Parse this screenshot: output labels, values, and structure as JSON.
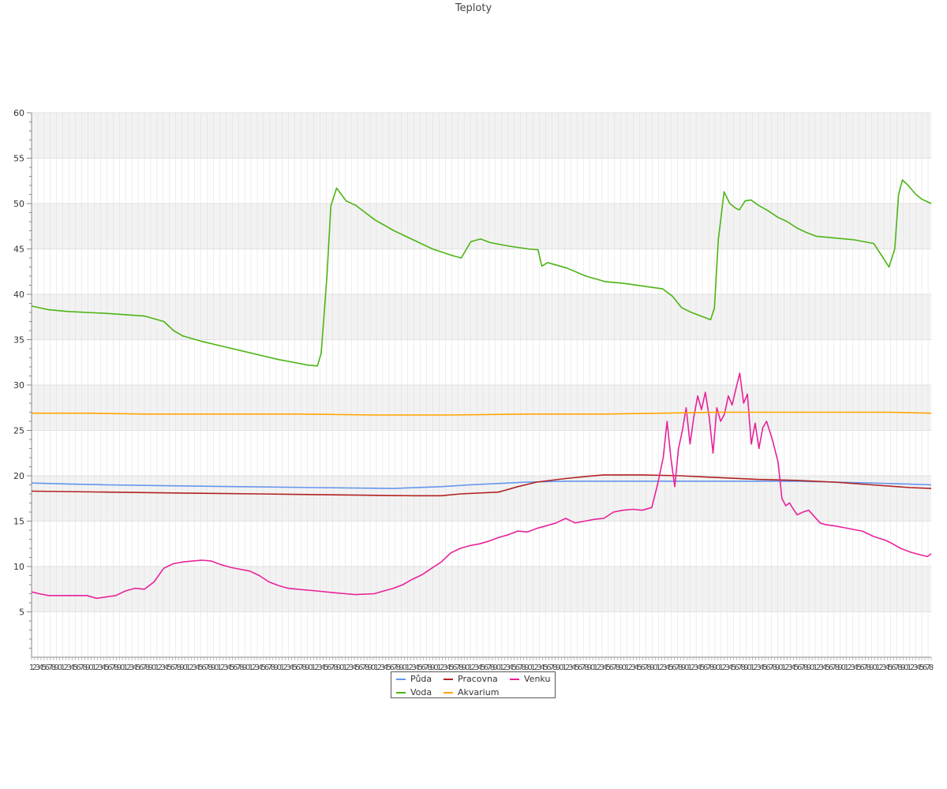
{
  "chart_data": {
    "type": "line",
    "title": "Teploty",
    "xlabel": "",
    "ylabel": "",
    "ylim": [
      0,
      60
    ],
    "yticks": [
      5,
      10,
      15,
      20,
      25,
      30,
      35,
      40,
      45,
      50,
      55,
      60
    ],
    "x_range": [
      1,
      288
    ],
    "x_tick_labels": "1 3 5 6 7 8 ... 288 (one dense label per sample, overlapping)",
    "grid": "alternating horizontal bands and vertical lines per sample",
    "legend_position": "bottom-center",
    "series": [
      {
        "name": "Půda",
        "color": "#6495ed",
        "points": [
          [
            1,
            19.2
          ],
          [
            20,
            19.1
          ],
          [
            40,
            19.0
          ],
          [
            70,
            18.9
          ],
          [
            110,
            18.8
          ],
          [
            150,
            18.7
          ],
          [
            190,
            18.6
          ],
          [
            215,
            18.8
          ],
          [
            230,
            19.0
          ],
          [
            250,
            19.2
          ],
          [
            260,
            19.3
          ],
          [
            280,
            19.4
          ],
          [
            300,
            19.4
          ],
          [
            330,
            19.4
          ],
          [
            360,
            19.4
          ],
          [
            400,
            19.4
          ],
          [
            420,
            19.3
          ],
          [
            440,
            19.2
          ],
          [
            458,
            19.1
          ],
          [
            471,
            19.0
          ]
        ]
      },
      {
        "name": "Pracovna",
        "color": "#b22222",
        "points": [
          [
            1,
            18.3
          ],
          [
            40,
            18.2
          ],
          [
            80,
            18.1
          ],
          [
            120,
            18.0
          ],
          [
            160,
            17.9
          ],
          [
            200,
            17.8
          ],
          [
            215,
            17.8
          ],
          [
            225,
            18.0
          ],
          [
            245,
            18.2
          ],
          [
            255,
            18.8
          ],
          [
            265,
            19.3
          ],
          [
            280,
            19.7
          ],
          [
            290,
            19.9
          ],
          [
            300,
            20.1
          ],
          [
            320,
            20.1
          ],
          [
            340,
            20.0
          ],
          [
            360,
            19.8
          ],
          [
            380,
            19.6
          ],
          [
            400,
            19.5
          ],
          [
            420,
            19.3
          ],
          [
            440,
            19.0
          ],
          [
            460,
            18.7
          ],
          [
            471,
            18.6
          ]
        ]
      },
      {
        "name": "Venku",
        "color": "#e8229a",
        "points": [
          [
            1,
            7.2
          ],
          [
            5,
            7.0
          ],
          [
            10,
            6.8
          ],
          [
            20,
            6.8
          ],
          [
            30,
            6.8
          ],
          [
            35,
            6.5
          ],
          [
            45,
            6.8
          ],
          [
            50,
            7.3
          ],
          [
            55,
            7.6
          ],
          [
            60,
            7.5
          ],
          [
            65,
            8.3
          ],
          [
            70,
            9.8
          ],
          [
            75,
            10.3
          ],
          [
            80,
            10.5
          ],
          [
            85,
            10.6
          ],
          [
            90,
            10.7
          ],
          [
            95,
            10.6
          ],
          [
            100,
            10.2
          ],
          [
            105,
            9.9
          ],
          [
            110,
            9.7
          ],
          [
            115,
            9.5
          ],
          [
            120,
            9.0
          ],
          [
            125,
            8.3
          ],
          [
            130,
            7.9
          ],
          [
            135,
            7.6
          ],
          [
            140,
            7.5
          ],
          [
            150,
            7.3
          ],
          [
            160,
            7.1
          ],
          [
            165,
            7.0
          ],
          [
            170,
            6.9
          ],
          [
            180,
            7.0
          ],
          [
            185,
            7.3
          ],
          [
            190,
            7.6
          ],
          [
            195,
            8.0
          ],
          [
            200,
            8.6
          ],
          [
            205,
            9.1
          ],
          [
            210,
            9.8
          ],
          [
            215,
            10.5
          ],
          [
            220,
            11.5
          ],
          [
            225,
            12.0
          ],
          [
            230,
            12.3
          ],
          [
            235,
            12.5
          ],
          [
            240,
            12.8
          ],
          [
            245,
            13.2
          ],
          [
            250,
            13.5
          ],
          [
            255,
            13.9
          ],
          [
            260,
            13.8
          ],
          [
            265,
            14.2
          ],
          [
            270,
            14.5
          ],
          [
            275,
            14.8
          ],
          [
            280,
            15.3
          ],
          [
            285,
            14.8
          ],
          [
            290,
            15.0
          ],
          [
            295,
            15.2
          ],
          [
            300,
            15.3
          ],
          [
            305,
            16.0
          ],
          [
            310,
            16.2
          ],
          [
            315,
            16.3
          ],
          [
            320,
            16.2
          ],
          [
            325,
            16.5
          ],
          [
            328,
            19.0
          ],
          [
            331,
            22.0
          ],
          [
            333,
            26.0
          ],
          [
            335,
            22.0
          ],
          [
            337,
            18.8
          ],
          [
            339,
            23.0
          ],
          [
            341,
            25.0
          ],
          [
            343,
            27.5
          ],
          [
            345,
            23.5
          ],
          [
            347,
            26.5
          ],
          [
            349,
            28.8
          ],
          [
            351,
            27.3
          ],
          [
            353,
            29.2
          ],
          [
            355,
            26.5
          ],
          [
            357,
            22.5
          ],
          [
            359,
            27.5
          ],
          [
            361,
            26.0
          ],
          [
            363,
            26.8
          ],
          [
            365,
            28.8
          ],
          [
            367,
            27.8
          ],
          [
            369,
            29.6
          ],
          [
            371,
            31.3
          ],
          [
            373,
            28.0
          ],
          [
            375,
            29.0
          ],
          [
            377,
            23.5
          ],
          [
            379,
            25.8
          ],
          [
            381,
            23.0
          ],
          [
            383,
            25.3
          ],
          [
            385,
            26.0
          ],
          [
            388,
            24.0
          ],
          [
            391,
            21.5
          ],
          [
            393,
            17.5
          ],
          [
            395,
            16.7
          ],
          [
            397,
            17.0
          ],
          [
            399,
            16.3
          ],
          [
            401,
            15.7
          ],
          [
            404,
            16.0
          ],
          [
            407,
            16.2
          ],
          [
            410,
            15.5
          ],
          [
            413,
            14.8
          ],
          [
            416,
            14.6
          ],
          [
            420,
            14.5
          ],
          [
            425,
            14.3
          ],
          [
            430,
            14.1
          ],
          [
            435,
            13.9
          ],
          [
            438,
            13.6
          ],
          [
            441,
            13.3
          ],
          [
            444,
            13.1
          ],
          [
            447,
            12.9
          ],
          [
            450,
            12.6
          ],
          [
            455,
            12.0
          ],
          [
            460,
            11.6
          ],
          [
            465,
            11.3
          ],
          [
            469,
            11.1
          ],
          [
            471,
            11.4
          ]
        ]
      },
      {
        "name": "Voda",
        "color": "#4cb414",
        "points": [
          [
            1,
            38.7
          ],
          [
            10,
            38.3
          ],
          [
            20,
            38.1
          ],
          [
            40,
            37.9
          ],
          [
            60,
            37.6
          ],
          [
            70,
            37.0
          ],
          [
            75,
            36.0
          ],
          [
            80,
            35.4
          ],
          [
            90,
            34.8
          ],
          [
            100,
            34.3
          ],
          [
            110,
            33.8
          ],
          [
            120,
            33.3
          ],
          [
            130,
            32.8
          ],
          [
            140,
            32.4
          ],
          [
            145,
            32.2
          ],
          [
            150,
            32.1
          ],
          [
            152,
            33.5
          ],
          [
            155,
            42.0
          ],
          [
            157,
            49.7
          ],
          [
            160,
            51.7
          ],
          [
            165,
            50.3
          ],
          [
            170,
            49.8
          ],
          [
            175,
            49.0
          ],
          [
            180,
            48.2
          ],
          [
            190,
            47.0
          ],
          [
            200,
            46.0
          ],
          [
            210,
            45.0
          ],
          [
            220,
            44.3
          ],
          [
            225,
            44.0
          ],
          [
            230,
            45.8
          ],
          [
            235,
            46.1
          ],
          [
            240,
            45.7
          ],
          [
            250,
            45.3
          ],
          [
            260,
            45.0
          ],
          [
            265,
            44.9
          ],
          [
            267,
            43.1
          ],
          [
            270,
            43.5
          ],
          [
            280,
            42.9
          ],
          [
            290,
            42.0
          ],
          [
            300,
            41.4
          ],
          [
            310,
            41.2
          ],
          [
            320,
            40.9
          ],
          [
            330,
            40.6
          ],
          [
            335,
            39.8
          ],
          [
            340,
            38.5
          ],
          [
            345,
            38.0
          ],
          [
            350,
            37.6
          ],
          [
            355,
            37.2
          ],
          [
            357,
            38.5
          ],
          [
            359,
            46.0
          ],
          [
            362,
            51.3
          ],
          [
            365,
            50.0
          ],
          [
            368,
            49.5
          ],
          [
            370,
            49.3
          ],
          [
            373,
            50.3
          ],
          [
            376,
            50.4
          ],
          [
            380,
            49.8
          ],
          [
            385,
            49.2
          ],
          [
            390,
            48.5
          ],
          [
            395,
            48.0
          ],
          [
            400,
            47.3
          ],
          [
            405,
            46.8
          ],
          [
            410,
            46.4
          ],
          [
            420,
            46.2
          ],
          [
            430,
            46.0
          ],
          [
            440,
            45.6
          ],
          [
            445,
            44.0
          ],
          [
            448,
            43.0
          ],
          [
            451,
            45.0
          ],
          [
            453,
            51.0
          ],
          [
            455,
            52.6
          ],
          [
            458,
            52.0
          ],
          [
            462,
            51.0
          ],
          [
            465,
            50.5
          ],
          [
            470,
            50.0
          ]
        ]
      },
      {
        "name": "Akvarium",
        "color": "#ffa500",
        "points": [
          [
            1,
            26.9
          ],
          [
            30,
            26.9
          ],
          [
            60,
            26.8
          ],
          [
            100,
            26.8
          ],
          [
            140,
            26.8
          ],
          [
            180,
            26.7
          ],
          [
            220,
            26.7
          ],
          [
            260,
            26.8
          ],
          [
            300,
            26.8
          ],
          [
            330,
            26.9
          ],
          [
            360,
            27.0
          ],
          [
            390,
            27.0
          ],
          [
            420,
            27.0
          ],
          [
            450,
            27.0
          ],
          [
            471,
            26.9
          ]
        ]
      }
    ]
  },
  "legend": {
    "items": [
      {
        "label": "Půda",
        "color": "#6495ed"
      },
      {
        "label": "Pracovna",
        "color": "#b22222"
      },
      {
        "label": "Venku",
        "color": "#e8229a"
      },
      {
        "label": "Voda",
        "color": "#4cb414"
      },
      {
        "label": "Akvarium",
        "color": "#ffa500"
      }
    ]
  }
}
